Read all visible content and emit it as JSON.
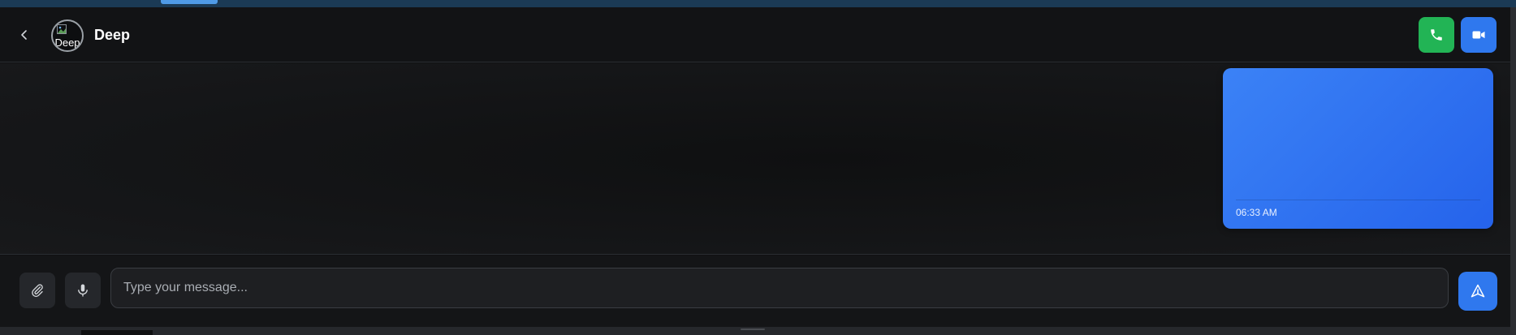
{
  "header": {
    "contact_name": "Deep",
    "avatar_alt": "Deep",
    "icons": {
      "back": "chevron-left-icon",
      "phone": "phone-icon",
      "video": "video-camera-icon"
    }
  },
  "messages": [
    {
      "direction": "outgoing",
      "time": "06:33 AM"
    }
  ],
  "composer": {
    "placeholder": "Type your message...",
    "value": "",
    "icons": {
      "attach": "paperclip-icon",
      "mic": "microphone-icon",
      "send": "send-icon"
    }
  },
  "colors": {
    "phone_button": "#22b455",
    "video_button": "#2f78ee",
    "bubble": "#3b82f6",
    "send_button": "#2f78ee"
  }
}
